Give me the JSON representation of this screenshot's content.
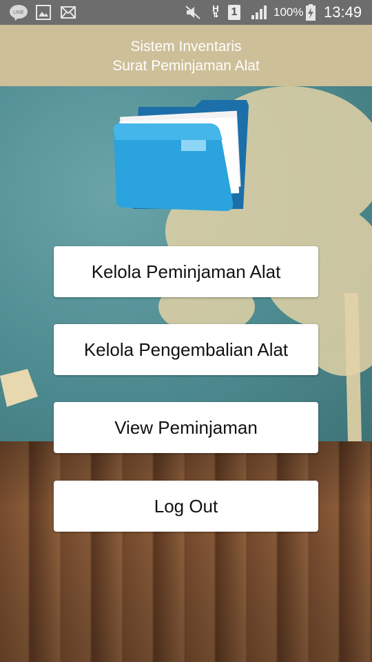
{
  "status_bar": {
    "icons": [
      "line-icon",
      "gallery-icon",
      "mail-icon",
      "mute-icon",
      "h-network-icon",
      "sim-icon",
      "signal-icon",
      "battery-icon"
    ],
    "h_label": "H",
    "sim_label": "1",
    "battery_percent": "100%",
    "time": "13:49"
  },
  "app_bar": {
    "title_line1": "Sistem Inventaris",
    "title_line2": "Surat Peminjaman Alat",
    "color": "#cdbf98"
  },
  "main": {
    "logo_icon": "folder-icon",
    "buttons": [
      {
        "label": "Kelola Peminjaman Alat"
      },
      {
        "label": "Kelola Pengembalian Alat"
      },
      {
        "label": "View Peminjaman"
      },
      {
        "label": "Log Out"
      }
    ]
  }
}
